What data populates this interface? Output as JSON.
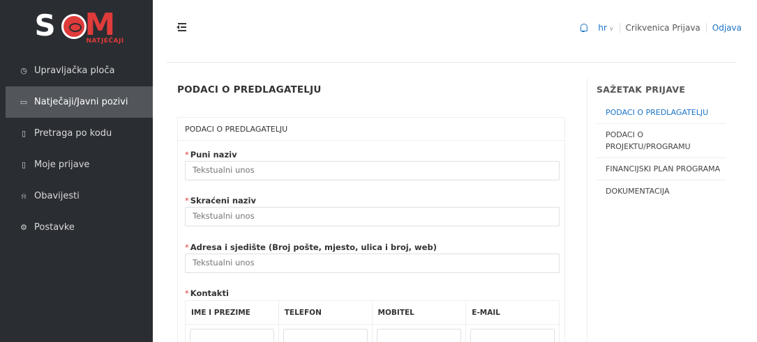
{
  "brand": {
    "logo_text": "SOM",
    "tagline": "NATJEČAJI"
  },
  "sidebar": {
    "items": [
      {
        "label": "Upravljačka ploča",
        "icon": "gauge-icon"
      },
      {
        "label": "Natječaji/Javni pozivi",
        "icon": "folder-open-icon"
      },
      {
        "label": "Pretraga po kodu",
        "icon": "document-icon"
      },
      {
        "label": "Moje prijave",
        "icon": "document-icon"
      },
      {
        "label": "Obavijesti",
        "icon": "bell-icon"
      },
      {
        "label": "Postavke",
        "icon": "gear-icon"
      }
    ],
    "active_index": 1
  },
  "header": {
    "language": "hr",
    "user": "Crikvenica Prijava",
    "logout": "Odjava"
  },
  "main": {
    "page_title": "PODACI O PREDLAGATELJU",
    "card_title": "PODACI O PREDLAGATELJU",
    "fields": [
      {
        "label": "Puni naziv",
        "placeholder": "Tekstualni unos"
      },
      {
        "label": "Skraćeni naziv",
        "placeholder": "Tekstualni unos"
      },
      {
        "label": "Adresa i sjedište (Broj pošte, mjesto, ulica i broj, web)",
        "placeholder": "Tekstualni unos"
      }
    ],
    "contacts": {
      "label": "Kontakti",
      "columns": [
        "IME I PREZIME",
        "TELEFON",
        "MOBITEL",
        "E-MAIL"
      ]
    }
  },
  "summary": {
    "title": "SAŽETAK PRIJAVE",
    "items": [
      {
        "label": "PODACI O PREDLAGATELJU"
      },
      {
        "label": "PODACI O PROJEKTU/PROGRAMU"
      },
      {
        "label": "FINANCIJSKI PLAN PROGRAMA"
      },
      {
        "label": "DOKUMENTACIJA"
      }
    ]
  },
  "colors": {
    "sidebar_bg": "#2a2d31",
    "accent_blue": "#1a73c8",
    "required_red": "#e03b3b",
    "brand_red": "#e03b3b"
  }
}
